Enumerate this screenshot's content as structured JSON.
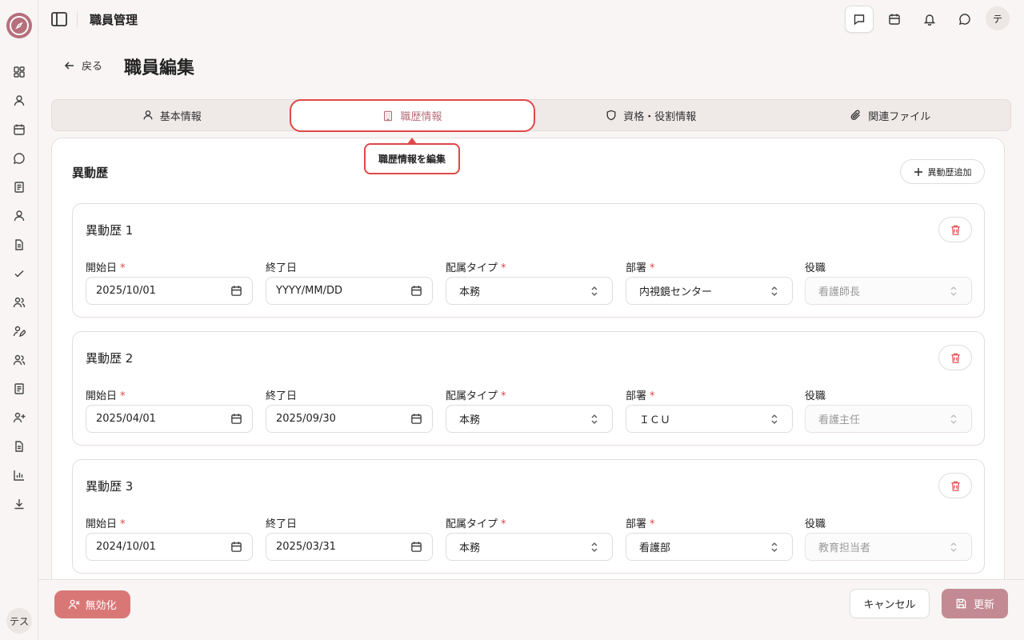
{
  "app": {
    "header_title": "職員管理",
    "user_initial": "テ",
    "sidebar_user": "テス"
  },
  "page": {
    "back_label": "戻る",
    "title": "職員編集"
  },
  "tabs": [
    {
      "label": "基本情報",
      "icon": "user-icon"
    },
    {
      "label": "職歴情報",
      "icon": "building-icon",
      "active": true
    },
    {
      "label": "資格・役割情報",
      "icon": "shield-icon"
    },
    {
      "label": "関連ファイル",
      "icon": "paperclip-icon"
    }
  ],
  "tooltip": "職歴情報を編集",
  "section": {
    "title": "異動歴",
    "add_label": "異動歴追加"
  },
  "labels": {
    "start": "開始日",
    "end": "終了日",
    "type": "配属タイプ",
    "dept": "部署",
    "position": "役職",
    "required": "*"
  },
  "histories": [
    {
      "title": "異動歴 1",
      "start": "2025/10/01",
      "end": "YYYY/MM/DD",
      "type": "本務",
      "dept": "内視鏡センター",
      "position": "看護師長"
    },
    {
      "title": "異動歴 2",
      "start": "2025/04/01",
      "end": "2025/09/30",
      "type": "本務",
      "dept": "ＩＣＵ",
      "position": "看護主任"
    },
    {
      "title": "異動歴 3",
      "start": "2024/10/01",
      "end": "2025/03/31",
      "type": "本務",
      "dept": "看護部",
      "position": "教育担当者"
    }
  ],
  "footer": {
    "deactivate": "無効化",
    "cancel": "キャンセル",
    "update": "更新"
  },
  "colors": {
    "accent": "#b5707b",
    "danger": "#d97777",
    "highlight": "#e04848"
  }
}
